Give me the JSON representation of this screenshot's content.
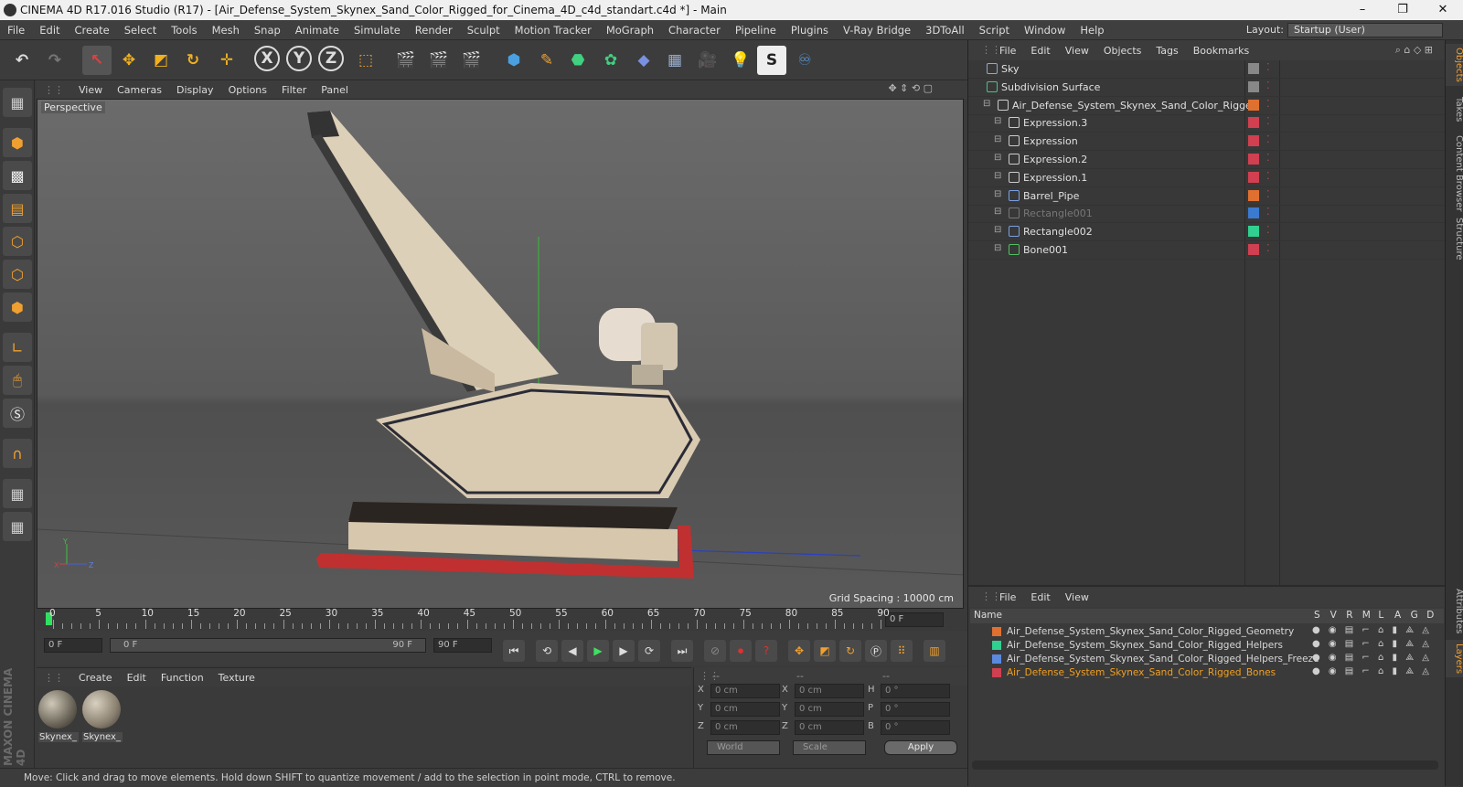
{
  "window": {
    "title": "CINEMA 4D R17.016 Studio (R17) - [Air_Defense_System_Skynex_Sand_Color_Rigged_for_Cinema_4D_c4d_standart.c4d *] - Main"
  },
  "menu": [
    "File",
    "Edit",
    "Create",
    "Select",
    "Tools",
    "Mesh",
    "Snap",
    "Animate",
    "Simulate",
    "Render",
    "Sculpt",
    "Motion Tracker",
    "MoGraph",
    "Character",
    "Pipeline",
    "Plugins",
    "V-Ray Bridge",
    "3DToAll",
    "Script",
    "Window",
    "Help"
  ],
  "layout": {
    "label": "Layout:",
    "value": "Startup (User)"
  },
  "viewport": {
    "menu": [
      "View",
      "Cameras",
      "Display",
      "Options",
      "Filter",
      "Panel"
    ],
    "label": "Perspective",
    "grid_spacing": "Grid Spacing : 10000 cm"
  },
  "timeline": {
    "ticks": [
      "0",
      "5",
      "10",
      "15",
      "20",
      "25",
      "30",
      "35",
      "40",
      "45",
      "50",
      "55",
      "60",
      "65",
      "70",
      "75",
      "80",
      "85",
      "90"
    ],
    "frame_field": "0 F"
  },
  "controls": {
    "start": "0 F",
    "range_start": "0 F",
    "range_end": "90 F",
    "end": "90 F"
  },
  "materials": {
    "menu": [
      "Create",
      "Edit",
      "Function",
      "Texture"
    ],
    "items": [
      "Skynex_",
      "Skynex_"
    ]
  },
  "coords": {
    "header": [
      "--",
      "--",
      "--"
    ],
    "rows": [
      {
        "a": "X",
        "av": "0 cm",
        "b": "X",
        "bv": "0 cm",
        "c": "H",
        "cv": "0 °"
      },
      {
        "a": "Y",
        "av": "0 cm",
        "b": "Y",
        "bv": "0 cm",
        "c": "P",
        "cv": "0 °"
      },
      {
        "a": "Z",
        "av": "0 cm",
        "b": "Z",
        "bv": "0 cm",
        "c": "B",
        "cv": "0 °"
      }
    ],
    "world": "World",
    "scale": "Scale",
    "apply": "Apply"
  },
  "status": "Move: Click and drag to move elements. Hold down SHIFT to quantize movement / add to the selection in point mode, CTRL to remove.",
  "objects": {
    "menu": [
      "File",
      "Edit",
      "View",
      "Objects",
      "Tags",
      "Bookmarks"
    ],
    "rows": [
      {
        "name": "Sky",
        "indent": 0,
        "color": "#8fa9c8",
        "dot": "#888"
      },
      {
        "name": "Subdivision Surface",
        "indent": 0,
        "color": "#4ac08a",
        "dot": "#888"
      },
      {
        "name": "Air_Defense_System_Skynex_Sand_Color_Rigged",
        "indent": 1,
        "color": "#cccccc",
        "dot": "#e07030"
      },
      {
        "name": "Expression.3",
        "indent": 2,
        "color": "#cccccc",
        "dot": "#d04050"
      },
      {
        "name": "Expression",
        "indent": 2,
        "color": "#cccccc",
        "dot": "#d04050"
      },
      {
        "name": "Expression.2",
        "indent": 2,
        "color": "#cccccc",
        "dot": "#d04050"
      },
      {
        "name": "Expression.1",
        "indent": 2,
        "color": "#cccccc",
        "dot": "#d04050"
      },
      {
        "name": "Barrel_Pipe",
        "indent": 2,
        "color": "#7aa0e0",
        "dot": "#e07030"
      },
      {
        "name": "Rectangle001",
        "indent": 2,
        "color": "#777777",
        "dot": "#3a7ad0"
      },
      {
        "name": "Rectangle002",
        "indent": 2,
        "color": "#7aa0e0",
        "dot": "#30d090"
      },
      {
        "name": "Bone001",
        "indent": 2,
        "color": "#50c060",
        "dot": "#d04050"
      }
    ]
  },
  "layers": {
    "menu": [
      "File",
      "Edit",
      "View"
    ],
    "header": {
      "name": "Name",
      "cols": [
        "S",
        "V",
        "R",
        "M",
        "L",
        "A",
        "G",
        "D"
      ]
    },
    "rows": [
      {
        "name": "Air_Defense_System_Skynex_Sand_Color_Rigged_Geometry",
        "color": "#e07030"
      },
      {
        "name": "Air_Defense_System_Skynex_Sand_Color_Rigged_Helpers",
        "color": "#30d090"
      },
      {
        "name": "Air_Defense_System_Skynex_Sand_Color_Rigged_Helpers_Freeze",
        "color": "#5a8ae0"
      },
      {
        "name": "Air_Defense_System_Skynex_Sand_Color_Rigged_Bones",
        "color": "#d04050",
        "highlight": "#f0a020"
      }
    ]
  },
  "sidetabs": [
    "Objects",
    "Takes",
    "Content Browser",
    "Structure",
    "Attributes",
    "Layers"
  ],
  "brand": "MAXON CINEMA 4D"
}
